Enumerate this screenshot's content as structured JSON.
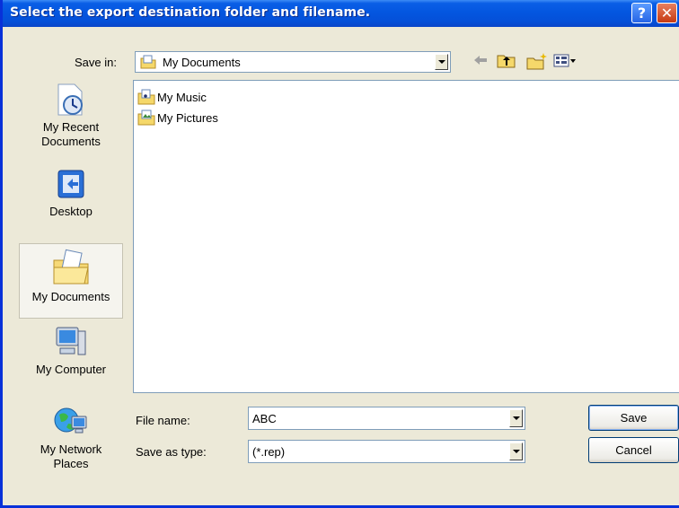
{
  "window": {
    "title": "Select the export destination folder and filename.",
    "help_glyph": "?",
    "close_glyph": "✕"
  },
  "save_in": {
    "label": "Save in:",
    "value": "My Documents"
  },
  "toolbar": {
    "icons": [
      "back-arrow-icon",
      "up-folder-icon",
      "new-folder-icon",
      "view-menu-icon"
    ]
  },
  "places": [
    {
      "label": "My Recent\nDocuments",
      "icon": "recent-documents-icon"
    },
    {
      "label": "Desktop",
      "icon": "desktop-icon"
    },
    {
      "label": "My Documents",
      "icon": "my-documents-icon",
      "selected": true
    },
    {
      "label": "My Computer",
      "icon": "my-computer-icon"
    },
    {
      "label": "My Network\nPlaces",
      "icon": "network-places-icon"
    }
  ],
  "files": [
    {
      "name": "My Music",
      "icon": "music-folder-icon"
    },
    {
      "name": "My Pictures",
      "icon": "pictures-folder-icon"
    }
  ],
  "file_name": {
    "label": "File name:",
    "value": "ABC"
  },
  "save_as_type": {
    "label": "Save as type:",
    "value": "(*.rep)"
  },
  "buttons": {
    "save": "Save",
    "cancel": "Cancel"
  },
  "colors": {
    "titlebar": "#0456e0",
    "dialog_bg": "#ece9d8",
    "field_border": "#7f9db9"
  }
}
